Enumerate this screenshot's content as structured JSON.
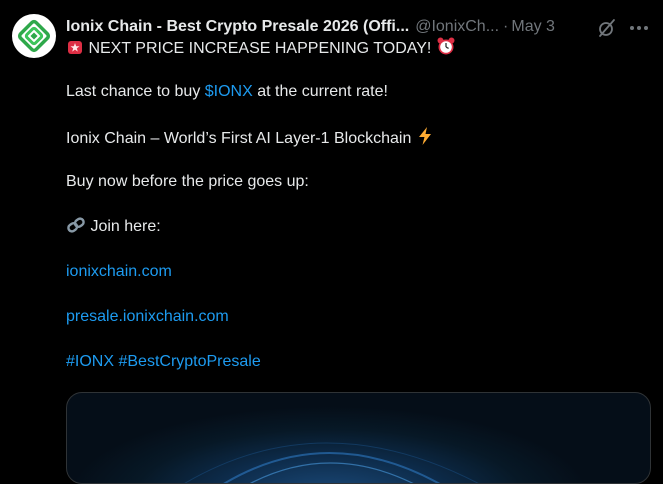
{
  "tweet": {
    "author_name": "Ionix Chain - Best Crypto Presale 2026 (Offi...",
    "handle": "@IonixCh...",
    "separator": "·",
    "date": "May 3",
    "lines": {
      "headline": "NEXT PRICE INCREASE HAPPENING TODAY!",
      "last_chance_prefix": "Last chance to buy ",
      "cashtag": "$IONX",
      "last_chance_suffix": " at the current rate!",
      "tagline": "Ionix Chain – World’s First AI Layer-1 Blockchain",
      "buy_now": "Buy now before the price goes up:",
      "join_here": "Join here:",
      "link_1": "ionixchain.com",
      "link_2": "presale.ionixchain.com",
      "hashtag_1": "#IONX",
      "hashtag_2": "#BestCryptoPresale"
    },
    "icons": [
      "avatar-logo",
      "siren-emoji",
      "alarm-clock-emoji",
      "lightning-emoji",
      "link-emoji",
      "grok-icon",
      "more-icon"
    ]
  },
  "colors": {
    "background": "#000000",
    "text": "#e7e9ea",
    "muted": "#71767b",
    "link": "#1d9bf0",
    "brand_green": "#3cc45a"
  }
}
